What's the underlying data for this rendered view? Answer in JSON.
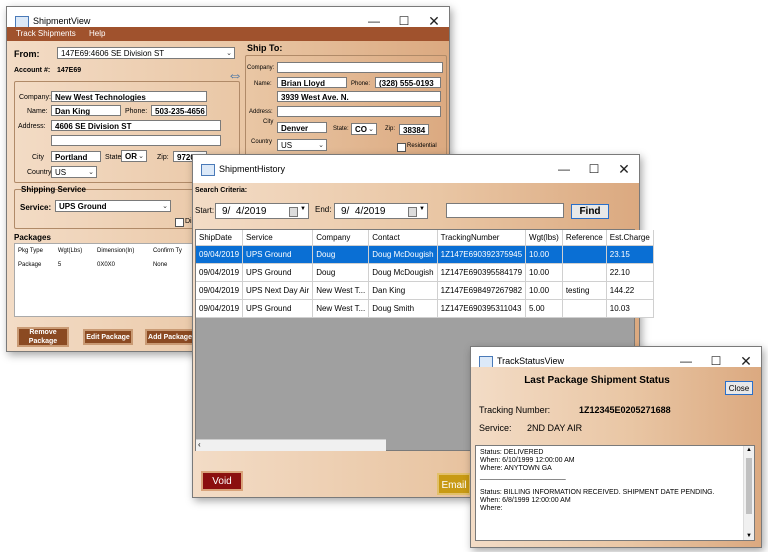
{
  "shipment_view": {
    "title": "ShipmentView",
    "menu": [
      "Track Shipments",
      "Help"
    ],
    "from_label": "From:",
    "from_value": "147E69:4606 SE Division ST",
    "account_label": "Account #:",
    "account_value": "147E69",
    "company_label": "Company:",
    "company_value": "New West Technologies",
    "name_label": "Name:",
    "name_value": "Dan King",
    "phone_label": "Phone:",
    "phone_value": "503-235-4656",
    "address_label": "Address:",
    "address_value": "4606 SE Division ST",
    "address2_value": "",
    "city_label": "City",
    "city_value": "Portland",
    "state_label": "State:",
    "state_value": "OR",
    "zip_label": "Zip:",
    "zip_value": "97206",
    "country_label": "Country:",
    "country_value": "US",
    "shipping_service_label": "Shipping Service",
    "service_label": "Service:",
    "service_value": "UPS Ground",
    "dir_checkbox_label": "Dir",
    "ship_to_label": "Ship To:",
    "to_company_label": "Company:",
    "to_company_value": "",
    "to_name_label": "Name:",
    "to_name_value": "Brian Lloyd",
    "to_phone_label": "Phone:",
    "to_phone_value": "(328) 555-0193",
    "to_address_value": "3939 West Ave. N.",
    "to_address_label": "Address:",
    "to_address2_value": "",
    "to_city_label": "City",
    "to_city_value": "Denver",
    "to_state_label": "State:",
    "to_state_value": "CO",
    "to_zip_label": "Zip:",
    "to_zip_value": "38384",
    "to_country_label": "Country",
    "to_country_value": "US",
    "residential_label": "Residential",
    "packages_label": "Packages",
    "pkg_columns": [
      "Pkg Type",
      "Wgt(Lbs)",
      "Dimension(In)",
      "Confirm Ty"
    ],
    "pkg_rows": [
      [
        "Package",
        "5",
        "0X0X0",
        "None"
      ]
    ],
    "buttons": {
      "remove": "Remove Package",
      "edit": "Edit Package",
      "add": "Add Package"
    }
  },
  "shipment_history": {
    "title": "ShipmentHistory",
    "search_criteria_label": "Search Criteria:",
    "start_label": "Start:",
    "start_value": "9/  4/2019",
    "end_label": "End:",
    "end_value": "9/  4/2019",
    "search_value": "",
    "find_label": "Find",
    "columns": [
      "ShipDate",
      "Service",
      "Company",
      "Contact",
      "TrackingNumber",
      "Wgt(lbs)",
      "Reference",
      "Est.Charge"
    ],
    "rows": [
      [
        "09/04/2019",
        "UPS Ground",
        "Doug",
        "Doug McDougish",
        "1Z147E690392375945",
        "10.00",
        "",
        "23.15"
      ],
      [
        "09/04/2019",
        "UPS Ground",
        "Doug",
        "Doug McDougish",
        "1Z147E690395584179",
        "10.00",
        "",
        "22.10"
      ],
      [
        "09/04/2019",
        "UPS Next Day Air",
        "New West T...",
        "Dan King",
        "1Z147E698497267982",
        "10.00",
        "testing",
        "144.22"
      ],
      [
        "09/04/2019",
        "UPS Ground",
        "New West T...",
        "Doug Smith",
        "1Z147E690395311043",
        "5.00",
        "",
        "10.03"
      ]
    ],
    "void_label": "Void",
    "email_label": "Email"
  },
  "track_status": {
    "title": "TrackStatusView",
    "heading": "Last Package Shipment Status",
    "close_label": "Close",
    "tracking_label": "Tracking Number:",
    "tracking_value": "1Z12345E0205271688",
    "service_label": "Service:",
    "service_value": "2ND DAY AIR",
    "log_lines": [
      "Status: DELIVERED",
      "When: 6/10/1999 12:00:00 AM",
      "Where:  ANYTOWN GA",
      "______________________",
      "",
      "Status: BILLING INFORMATION RECEIVED. SHIPMENT DATE PENDING.",
      "When: 6/8/1999 12:00:00 AM",
      "Where:"
    ]
  },
  "colors": {
    "menu_bar": "#a0522d",
    "brown_button": "#8b4a22",
    "void_button": "#8b0f0f",
    "selection": "#0a6fd4",
    "gradient_light": "#f3dcc6",
    "gradient_dark": "#dba980"
  },
  "icons": [
    "window-icon",
    "minimize-icon",
    "maximize-icon",
    "close-icon",
    "swap-arrows-icon",
    "calendar-icon",
    "chevron-down-icon"
  ]
}
